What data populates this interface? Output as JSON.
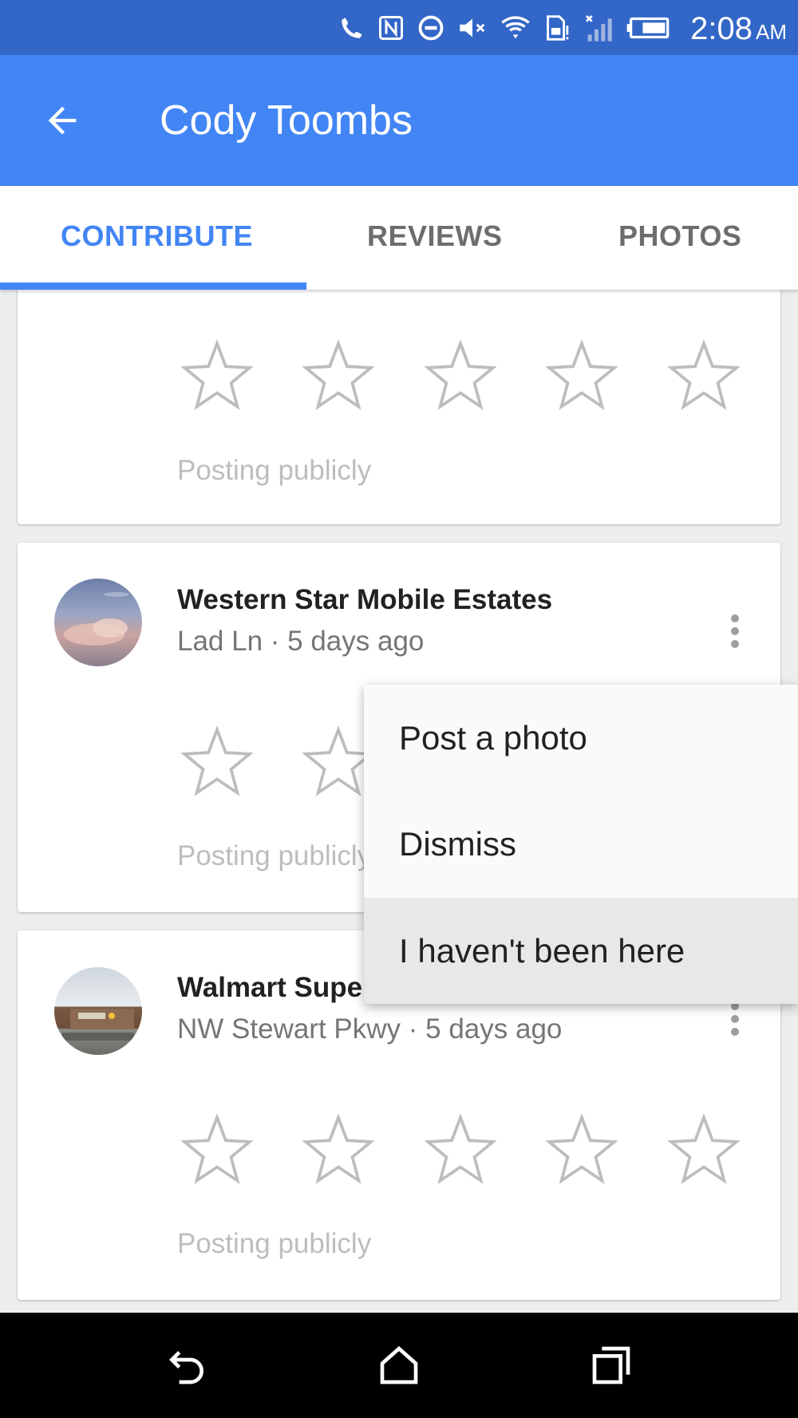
{
  "status_bar": {
    "time": "2:08",
    "ampm": "AM",
    "icons": [
      "phone-icon",
      "nfc-icon",
      "do-not-disturb-icon",
      "mute-icon",
      "wifi-icon",
      "sd-card-icon",
      "signal-icon",
      "battery-icon"
    ]
  },
  "app_bar": {
    "title": "Cody Toombs",
    "back_icon": "arrow-back-icon"
  },
  "tabs": [
    {
      "label": "CONTRIBUTE",
      "active": true
    },
    {
      "label": "REVIEWS",
      "active": false
    },
    {
      "label": "PHOTOS",
      "active": false
    }
  ],
  "cards": [
    {
      "name": "",
      "subtitle": "",
      "rating": 0,
      "posting_label": "Posting publicly"
    },
    {
      "name": "Western Star Mobile Estates",
      "subtitle": "Lad Ln · 5 days ago",
      "rating": 0,
      "posting_label": "Posting publicly"
    },
    {
      "name": "Walmart Supe",
      "subtitle": "NW Stewart Pkwy · 5 days ago",
      "rating": 0,
      "posting_label": "Posting publicly"
    }
  ],
  "overflow_menu": {
    "items": [
      "Post a photo",
      "Dismiss",
      "I haven't been here"
    ],
    "highlighted_index": 2
  },
  "nav_bar": {
    "icons": [
      "back-nav-icon",
      "home-icon",
      "recents-icon"
    ]
  },
  "colors": {
    "primary": "#4285f4",
    "status_bar": "#3367c7",
    "star_outline": "#bdbdbd"
  }
}
